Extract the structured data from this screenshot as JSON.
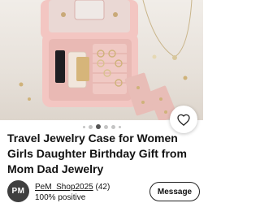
{
  "listing": {
    "title": "Travel Jewelry Case for Women Girls Daughter Birthday Gift from Mom Dad Jewelry",
    "image_alt": "pink jewelry case photo",
    "carousel": {
      "count": 6,
      "active_index": 2
    }
  },
  "seller": {
    "avatar_initials": "PM",
    "username": "PeM_Shop2025",
    "feedback_count": "(42)",
    "positive": "100% positive"
  },
  "actions": {
    "message_label": "Message",
    "favorite_icon": "heart-icon"
  },
  "colors": {
    "case_pink": "#f3c6c2",
    "background": "#ece6df",
    "avatar": "#3f3f3f"
  }
}
